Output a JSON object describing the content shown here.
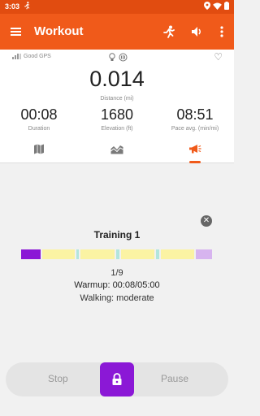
{
  "status_bar": {
    "time": "3:03"
  },
  "app_bar": {
    "title": "Workout"
  },
  "panel": {
    "gps_label": "Good GPS",
    "distance_value": "0.014",
    "distance_label": "Distance (mi)",
    "stats": [
      {
        "value": "00:08",
        "label": "Duration"
      },
      {
        "value": "1680",
        "label": "Elevation (ft)"
      },
      {
        "value": "08:51",
        "label": "Pace avg. (min/mi)"
      }
    ],
    "tabs": [
      "map",
      "chart",
      "voice"
    ]
  },
  "training": {
    "title": "Training 1",
    "counter": "1/9",
    "current_step": "Warmup: 00:08/05:00",
    "step_detail": "Walking: moderate",
    "segments": [
      {
        "color": "#8b18d6",
        "weight": 1
      },
      {
        "color": "#fbf3a3",
        "weight": 1.6
      },
      {
        "color": "#b2e5dd",
        "weight": 0.15
      },
      {
        "color": "#fbf3a3",
        "weight": 1.7
      },
      {
        "color": "#b2e5dd",
        "weight": 0.15
      },
      {
        "color": "#fbf3a3",
        "weight": 1.7
      },
      {
        "color": "#b2e5dd",
        "weight": 0.15
      },
      {
        "color": "#fbf3a3",
        "weight": 1.7
      },
      {
        "color": "#d7b4ef",
        "weight": 0.8
      }
    ]
  },
  "controls": {
    "stop_label": "Stop",
    "pause_label": "Pause"
  },
  "colors": {
    "accent": "#f05a1a",
    "status_bar": "#e14c10",
    "lock": "#8b18d6"
  }
}
